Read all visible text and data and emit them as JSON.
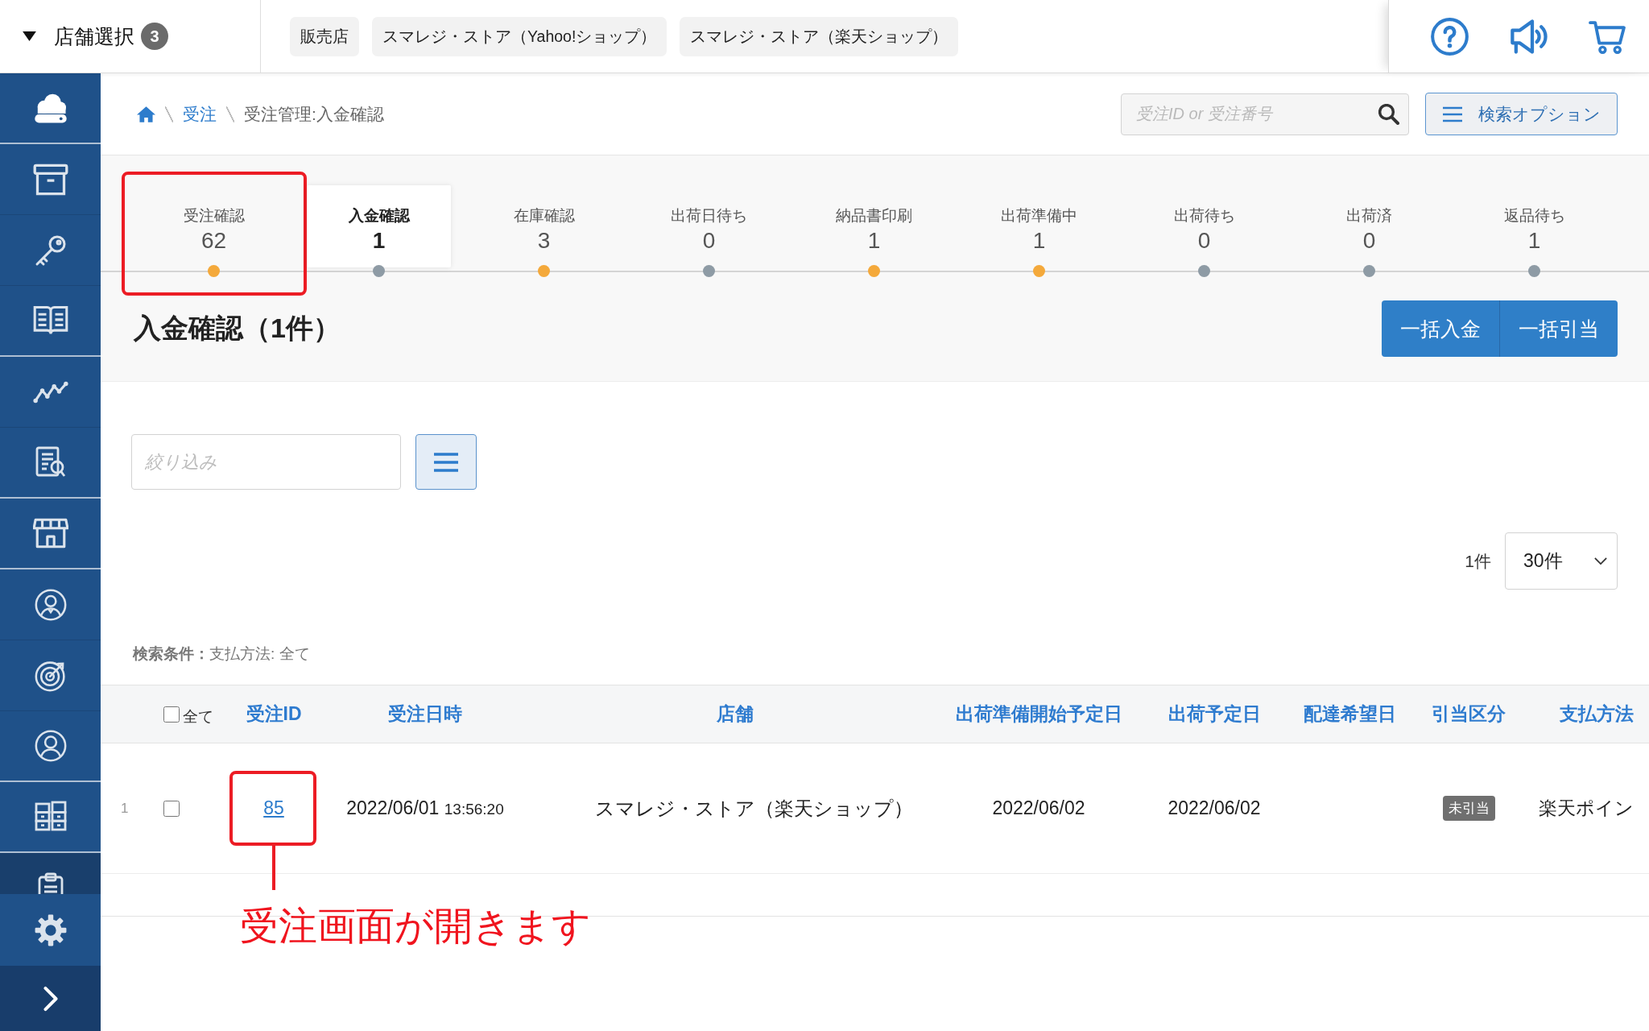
{
  "store_selector": {
    "label": "店舗選択",
    "count": "3"
  },
  "store_chips": [
    "販売店",
    "スマレジ・ストア（Yahoo!ショップ）",
    "スマレジ・ストア（楽天ショップ）"
  ],
  "breadcrumb": [
    {
      "label": "受注",
      "kind": "link"
    },
    {
      "label": "受注管理:入金確認",
      "kind": "current"
    }
  ],
  "search": {
    "placeholder": "受注ID or 受注番号"
  },
  "search_options_button": "検索オプション",
  "status_tabs": [
    {
      "label": "受注確認",
      "count": "62",
      "selected": false,
      "color": "#f4a93b",
      "highlighted": true
    },
    {
      "label": "入金確認",
      "count": "1",
      "selected": true,
      "color": "#8e9ba5",
      "highlighted": false
    },
    {
      "label": "在庫確認",
      "count": "3",
      "selected": false,
      "color": "#f4a93b",
      "highlighted": false
    },
    {
      "label": "出荷日待ち",
      "count": "0",
      "selected": false,
      "color": "#8e9ba5",
      "highlighted": false
    },
    {
      "label": "納品書印刷",
      "count": "1",
      "selected": false,
      "color": "#f4a93b",
      "highlighted": false
    },
    {
      "label": "出荷準備中",
      "count": "1",
      "selected": false,
      "color": "#f4a93b",
      "highlighted": false
    },
    {
      "label": "出荷待ち",
      "count": "0",
      "selected": false,
      "color": "#8e9ba5",
      "highlighted": false
    },
    {
      "label": "出荷済",
      "count": "0",
      "selected": false,
      "color": "#8e9ba5",
      "highlighted": false
    },
    {
      "label": "返品待ち",
      "count": "1",
      "selected": false,
      "color": "#8e9ba5",
      "highlighted": false
    }
  ],
  "heading": "入金確認（1件）",
  "bulk_actions": [
    "一括入金",
    "一括引当"
  ],
  "filter": {
    "placeholder": "絞り込み"
  },
  "pagination": {
    "total": "1件",
    "page_size": "30件"
  },
  "search_conditions": "**検索条件：**支払方法: 全て",
  "table": {
    "select_all": {
      "label": "全て",
      "checked": false
    },
    "columns": [
      "受注ID",
      "受注日時",
      "店舗",
      "出荷準備開始予定日",
      "出荷予定日",
      "配達希望日",
      "引当区分",
      "支払方法"
    ],
    "rows": [
      {
        "number": "1",
        "checked": false,
        "order_id": "85",
        "highlighted": true,
        "ordered_date": "2022/06/01",
        "ordered_time": "13:56:20",
        "store": "スマレジ・ストア（楽天ショップ）",
        "ship_prep_start_date": "2022/06/02",
        "ship_date": "2022/06/02",
        "allocation": "未引当",
        "payment": "楽天ポイン"
      }
    ]
  },
  "callout": {
    "text": "受注画面が開きます"
  }
}
